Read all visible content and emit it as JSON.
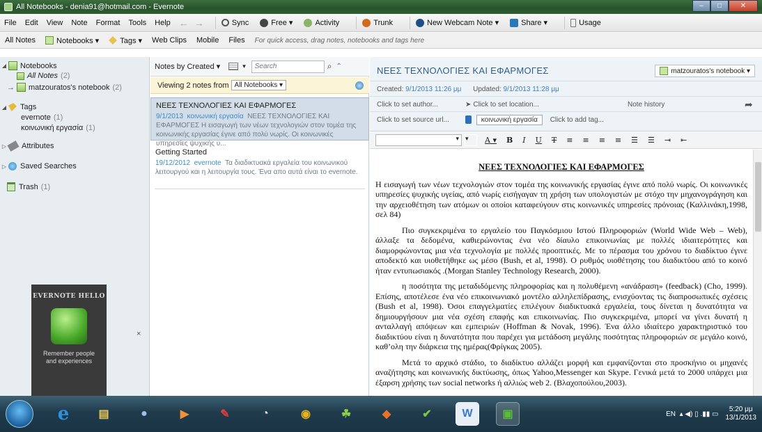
{
  "window": {
    "title": "All Notebooks - denia91@hotmail.com - Evernote",
    "controls": [
      "–",
      "□",
      "✕"
    ]
  },
  "menu": {
    "items": [
      "File",
      "Edit",
      "View",
      "Note",
      "Format",
      "Tools",
      "Help"
    ],
    "back": "←",
    "forward": "→",
    "sync": "Sync",
    "account": "Free ▾",
    "activity": "Activity",
    "trunk": "Trunk",
    "webcam": "New Webcam Note ▾",
    "share": "Share ▾",
    "usage": "Usage"
  },
  "toolbar2": {
    "all_notes": "All Notes",
    "notebooks": "Notebooks ▾",
    "tags": "Tags ▾",
    "web_clips": "Web Clips",
    "mobile": "Mobile",
    "files": "Files",
    "hint": "For quick access, drag notes, notebooks and tags here"
  },
  "sidebar": {
    "notebooks_header": "Notebooks",
    "all_notes_label": "All Notes",
    "all_notes_count": "(2)",
    "notebook_name": "matzouratos's notebook",
    "notebook_count": "(2)",
    "tags_header": "Tags",
    "tag1": "evernote",
    "tag1_count": "(1)",
    "tag2": "κοινωνική εργασία",
    "tag2_count": "(1)",
    "attributes": "Attributes",
    "saved_searches": "Saved Searches",
    "trash": "Trash",
    "trash_count": "(1)",
    "close_glyph": "×",
    "promo_title": "EVERNOTE HELLO",
    "promo_line1": "Remember people",
    "promo_line2": "and experiences"
  },
  "notelist": {
    "sort_label": "Notes by Created ▾",
    "view_toggle": "▾",
    "search_placeholder": "Search",
    "magnify_glyph": "⌕",
    "expand_glyph": "⌃",
    "viewing_prefix": "Viewing 2 notes from",
    "viewing_select": "All Notebooks ▾",
    "notes": [
      {
        "title": "ΝΕΕΣ ΤΕΧΝΟΛΟΓΙΕΣ ΚΑΙ ΕΦΑΡΜΟΓΕΣ",
        "date": "9/1/2013",
        "tag": "κοινωνική εργασία",
        "snippet": "ΝΕΕΣ ΤΕΧΝΟΛΟΓΙΕΣ ΚΑΙ ΕΦΑΡΜΟΓΕΣ Η εισαγωγή των νέων τεχνολογιών στον τομέα της κοινωνικής εργασίας έγινε από πολύ νωρίς. Οι κοινωνικές υπηρεσίες ψυχικής υ..."
      },
      {
        "title": "Getting Started",
        "date": "19/12/2012",
        "tag": "evernote",
        "snippet": "Τα διαδικτυακά εργαλεία του κοινωνικού λειτουργού και η λειτουργία τους. Ένα απο αυτά είναι το evernote."
      }
    ]
  },
  "editor": {
    "title": "ΝΕΕΣ ΤΕΧΝΟΛΟΓΙΕΣ ΚΑΙ ΕΦΑΡΜΟΓΕΣ",
    "notebook": "matzouratos's notebook ▾",
    "created_label": "Created:",
    "created": "9/1/2013 11:26 μμ",
    "updated_label": "Updated:",
    "updated": "9/1/2013 11:28 μμ",
    "author": "Click to set author...",
    "location": "Click to set location...",
    "history": "Note history",
    "share_arrow": "➦",
    "source": "Click to set source url...",
    "tag": "κοινωνική εργασία",
    "add_tag": "Click to add tag...",
    "format": [
      "A ▾",
      "B",
      "I",
      "U",
      "T",
      "≡",
      "≡",
      "≡",
      "≡",
      "☰",
      "☰",
      "⇥",
      "⇤"
    ],
    "font_dropdown": "▾",
    "size_dropdown": "▾",
    "doc_title": "ΝΕΕΣ ΤΕΧΝΟΛΟΓΙΕΣ ΚΑΙ ΕΦΑΡΜΟΓΕΣ",
    "p1": "Η εισαγωγή των νέων τεχνολογιών στον τομέα της κοινωνικής εργασίας  έγινε από πολύ νωρίς. Οι κοινωνικές υπηρεσίες ψυχικής υγείας, από νωρίς εισήγαγαν τη χρήση των υπολογιστών με στόχο την μηχανογράγηση και την αρχειοθέτηση των ατόμων οι οποίοι καταφεύγουν στις κοινωνικές υπηρεσίες πρόνοιας (Καλλινάκη,1998, σελ 84)",
    "p2": "Πιο συγκεκριμένα το εργαλείο  του Παγκόσμιου Ιστού Πληροφοριών (World Wide Web – Web), άλλαξε  τα δεδομένα, καθιερώνοντας ένα νέο δίαυλο επικοινωνίας με πολλές ιδιαιτερότητες και διαμορφώνοντας μια νέα τεχνολογία με πολλές προοπτικές. Με το πέρασμα του χρόνου το διαδίκτυο έγινε αποδεκτό και υιοθετήθηκε ως μέσο (Bush, et al, 1998). Ο ρυθμός υιοθέτησης του διαδικτύου  από το κοινό ήταν εντυπωσιακός .(Morgan Stanley Technology Research, 2000).",
    "p3": "η ποσότητα της μεταδιδόμενης πληροφορίας και η πολυθέμενη «ανάδραση» (feedback) (Cho, 1999). Επίσης, αποτέλεσε ένα νέο επικοινωνιακό μοντέλο αλληλεπίδρασης, ενισχύοντας τις διαπροσωπικές σχέσεις (Bush et al, 1998). Όσοι επαγγελματίες επιλέγουν διαδικτυακά εργαλεία, τους δίνεται η δυνατότητα να δημιουργήσουν μια νέα σχέση επαφής και επικοινωνίας. Πιο συγκεκριμένα, μπορεί να γίνει δυνατή η ανταλλαγή απόψεων και εμπειριών (Hoffman & Novak, 1996). Ένα άλλο ιδιαίτερο χαρακτηριστικό του διαδικτύου είναι η δυνατότητα που παρέχει για μετάδοση μεγάλης ποσότητας πληροφοριών σε μεγάλο κοινό, καθ’ολη την διάρκεια της ημέρας(Φρίγκας 2005).",
    "p4": "Μετά το αρχικό στάδιο, το διαδίκτυο αλλάζει μορφή και εμφανίζονται στο προσκήνιο οι μηχανές αναζήτησης και κοινωνικής δικτύωσης, όπως Yahoo,Messenger και Skype. Γενικά μετά το 2000 υπάρχει μια έξαρση χρήσης των social networks  ή αλλιώς web 2. (Βλαχοπούλου,2003)."
  },
  "taskbar": {
    "apps": [
      "e",
      "▤",
      "●",
      "▶",
      "✎",
      "◔",
      "◉",
      "☘",
      "◆",
      "✔",
      "W",
      "▣"
    ],
    "lang": "EN",
    "tray_icons": "▴ ◀) ▯ .▮▮ ▭",
    "time": "5:20 μμ",
    "date": "13/1/2013"
  },
  "colors": {
    "accent": "#3b7fc4",
    "titlebar": "#2f5f31",
    "selection": "#d3dde8",
    "viewing_bar": "#fbf4d6"
  }
}
